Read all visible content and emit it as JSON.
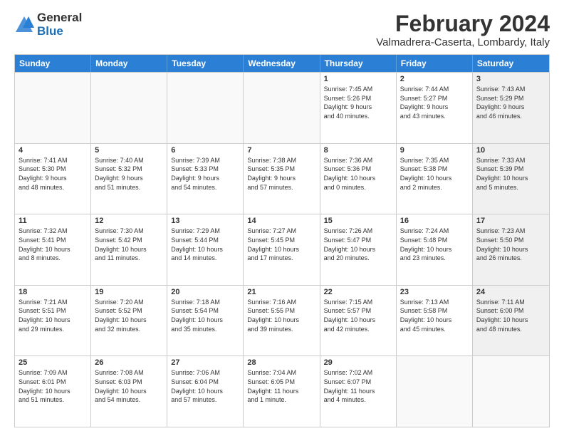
{
  "logo": {
    "general": "General",
    "blue": "Blue"
  },
  "title": "February 2024",
  "subtitle": "Valmadrera-Caserta, Lombardy, Italy",
  "headers": [
    "Sunday",
    "Monday",
    "Tuesday",
    "Wednesday",
    "Thursday",
    "Friday",
    "Saturday"
  ],
  "rows": [
    [
      {
        "day": "",
        "info": "",
        "empty": true
      },
      {
        "day": "",
        "info": "",
        "empty": true
      },
      {
        "day": "",
        "info": "",
        "empty": true
      },
      {
        "day": "",
        "info": "",
        "empty": true
      },
      {
        "day": "1",
        "info": "Sunrise: 7:45 AM\nSunset: 5:26 PM\nDaylight: 9 hours\nand 40 minutes."
      },
      {
        "day": "2",
        "info": "Sunrise: 7:44 AM\nSunset: 5:27 PM\nDaylight: 9 hours\nand 43 minutes."
      },
      {
        "day": "3",
        "info": "Sunrise: 7:43 AM\nSunset: 5:29 PM\nDaylight: 9 hours\nand 46 minutes.",
        "shaded": true
      }
    ],
    [
      {
        "day": "4",
        "info": "Sunrise: 7:41 AM\nSunset: 5:30 PM\nDaylight: 9 hours\nand 48 minutes."
      },
      {
        "day": "5",
        "info": "Sunrise: 7:40 AM\nSunset: 5:32 PM\nDaylight: 9 hours\nand 51 minutes."
      },
      {
        "day": "6",
        "info": "Sunrise: 7:39 AM\nSunset: 5:33 PM\nDaylight: 9 hours\nand 54 minutes."
      },
      {
        "day": "7",
        "info": "Sunrise: 7:38 AM\nSunset: 5:35 PM\nDaylight: 9 hours\nand 57 minutes."
      },
      {
        "day": "8",
        "info": "Sunrise: 7:36 AM\nSunset: 5:36 PM\nDaylight: 10 hours\nand 0 minutes."
      },
      {
        "day": "9",
        "info": "Sunrise: 7:35 AM\nSunset: 5:38 PM\nDaylight: 10 hours\nand 2 minutes."
      },
      {
        "day": "10",
        "info": "Sunrise: 7:33 AM\nSunset: 5:39 PM\nDaylight: 10 hours\nand 5 minutes.",
        "shaded": true
      }
    ],
    [
      {
        "day": "11",
        "info": "Sunrise: 7:32 AM\nSunset: 5:41 PM\nDaylight: 10 hours\nand 8 minutes."
      },
      {
        "day": "12",
        "info": "Sunrise: 7:30 AM\nSunset: 5:42 PM\nDaylight: 10 hours\nand 11 minutes."
      },
      {
        "day": "13",
        "info": "Sunrise: 7:29 AM\nSunset: 5:44 PM\nDaylight: 10 hours\nand 14 minutes."
      },
      {
        "day": "14",
        "info": "Sunrise: 7:27 AM\nSunset: 5:45 PM\nDaylight: 10 hours\nand 17 minutes."
      },
      {
        "day": "15",
        "info": "Sunrise: 7:26 AM\nSunset: 5:47 PM\nDaylight: 10 hours\nand 20 minutes."
      },
      {
        "day": "16",
        "info": "Sunrise: 7:24 AM\nSunset: 5:48 PM\nDaylight: 10 hours\nand 23 minutes."
      },
      {
        "day": "17",
        "info": "Sunrise: 7:23 AM\nSunset: 5:50 PM\nDaylight: 10 hours\nand 26 minutes.",
        "shaded": true
      }
    ],
    [
      {
        "day": "18",
        "info": "Sunrise: 7:21 AM\nSunset: 5:51 PM\nDaylight: 10 hours\nand 29 minutes."
      },
      {
        "day": "19",
        "info": "Sunrise: 7:20 AM\nSunset: 5:52 PM\nDaylight: 10 hours\nand 32 minutes."
      },
      {
        "day": "20",
        "info": "Sunrise: 7:18 AM\nSunset: 5:54 PM\nDaylight: 10 hours\nand 35 minutes."
      },
      {
        "day": "21",
        "info": "Sunrise: 7:16 AM\nSunset: 5:55 PM\nDaylight: 10 hours\nand 39 minutes."
      },
      {
        "day": "22",
        "info": "Sunrise: 7:15 AM\nSunset: 5:57 PM\nDaylight: 10 hours\nand 42 minutes."
      },
      {
        "day": "23",
        "info": "Sunrise: 7:13 AM\nSunset: 5:58 PM\nDaylight: 10 hours\nand 45 minutes."
      },
      {
        "day": "24",
        "info": "Sunrise: 7:11 AM\nSunset: 6:00 PM\nDaylight: 10 hours\nand 48 minutes.",
        "shaded": true
      }
    ],
    [
      {
        "day": "25",
        "info": "Sunrise: 7:09 AM\nSunset: 6:01 PM\nDaylight: 10 hours\nand 51 minutes."
      },
      {
        "day": "26",
        "info": "Sunrise: 7:08 AM\nSunset: 6:03 PM\nDaylight: 10 hours\nand 54 minutes."
      },
      {
        "day": "27",
        "info": "Sunrise: 7:06 AM\nSunset: 6:04 PM\nDaylight: 10 hours\nand 57 minutes."
      },
      {
        "day": "28",
        "info": "Sunrise: 7:04 AM\nSunset: 6:05 PM\nDaylight: 11 hours\nand 1 minute."
      },
      {
        "day": "29",
        "info": "Sunrise: 7:02 AM\nSunset: 6:07 PM\nDaylight: 11 hours\nand 4 minutes."
      },
      {
        "day": "",
        "info": "",
        "empty": true
      },
      {
        "day": "",
        "info": "",
        "empty": true,
        "shaded": true
      }
    ]
  ]
}
